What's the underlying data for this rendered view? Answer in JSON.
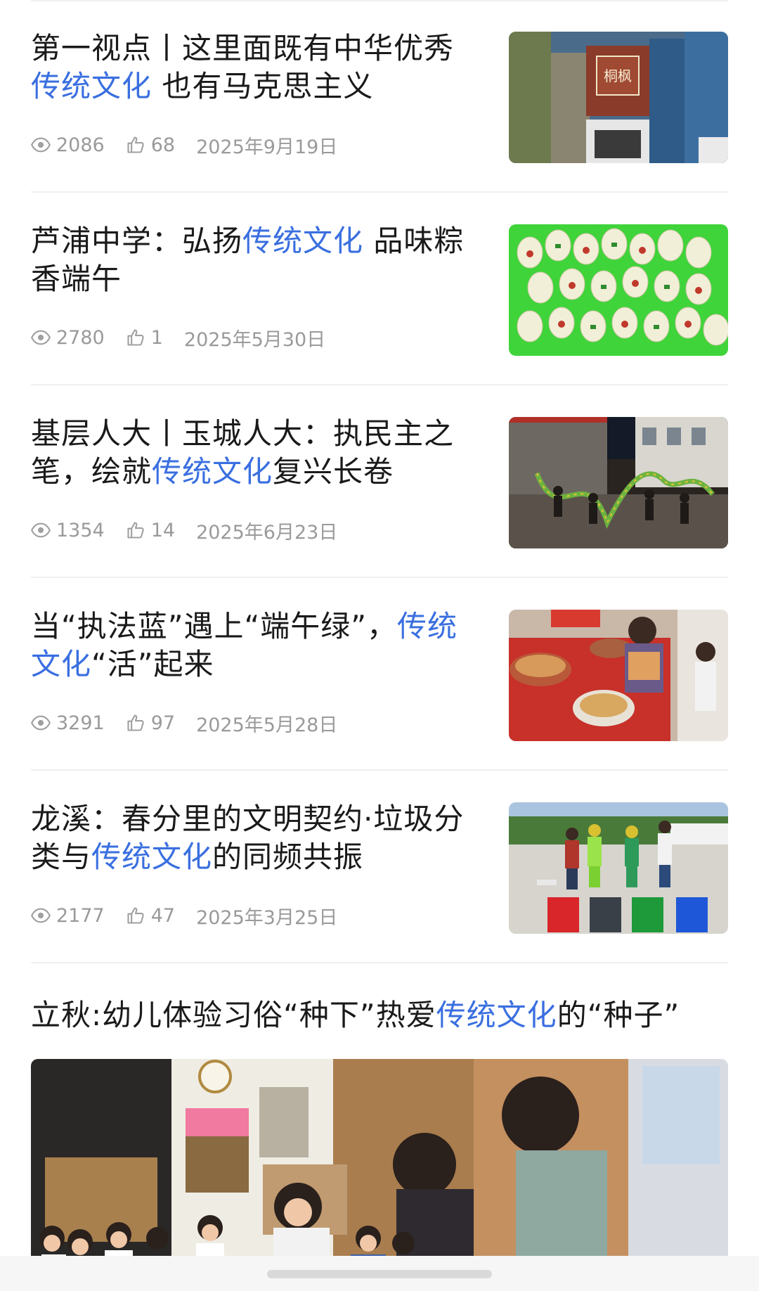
{
  "articles": [
    {
      "title_a": "第一视点丨这里面既有中华优秀",
      "title_hl": "传统文化",
      "title_b": " 也有马克思主义",
      "views": "2086",
      "likes": "68",
      "date": "2025年9月19日",
      "image": "aerial-museum-photo"
    },
    {
      "title_a": "芦浦中学：弘扬",
      "title_hl": "传统文化",
      "title_b": " 品味粽香端午",
      "views": "2780",
      "likes": "1",
      "date": "2025年5月30日",
      "image": "painted-eggs-photo"
    },
    {
      "title_a": "基层人大丨玉城人大：执民主之笔，绘就",
      "title_hl": "传统文化",
      "title_b": "复兴长卷",
      "views": "1354",
      "likes": "14",
      "date": "2025年6月23日",
      "image": "dragon-dance-photo"
    },
    {
      "title_a": "当“执法蓝”遇上“端午绿”，",
      "title_hl": "传统文化",
      "title_b": "“活”起来",
      "views": "3291",
      "likes": "97",
      "date": "2025年5月28日",
      "image": "zongzi-food-photo"
    },
    {
      "title_a": "龙溪：春分里的文明契约·垃圾分类与",
      "title_hl": "传统文化",
      "title_b": "的同频共振",
      "views": "2177",
      "likes": "47",
      "date": "2025年3月25日",
      "image": "garbage-sorting-photo"
    }
  ],
  "video_article": {
    "title_a": "立秋:幼儿体验习俗“种下”热爱",
    "title_hl": "传统文化",
    "title_b": "的“种子”",
    "image": "kindergarten-class-photo"
  },
  "colors": {
    "highlight": "#3a6fe0",
    "text": "#1a1a1a",
    "meta": "#9a9a9a"
  }
}
